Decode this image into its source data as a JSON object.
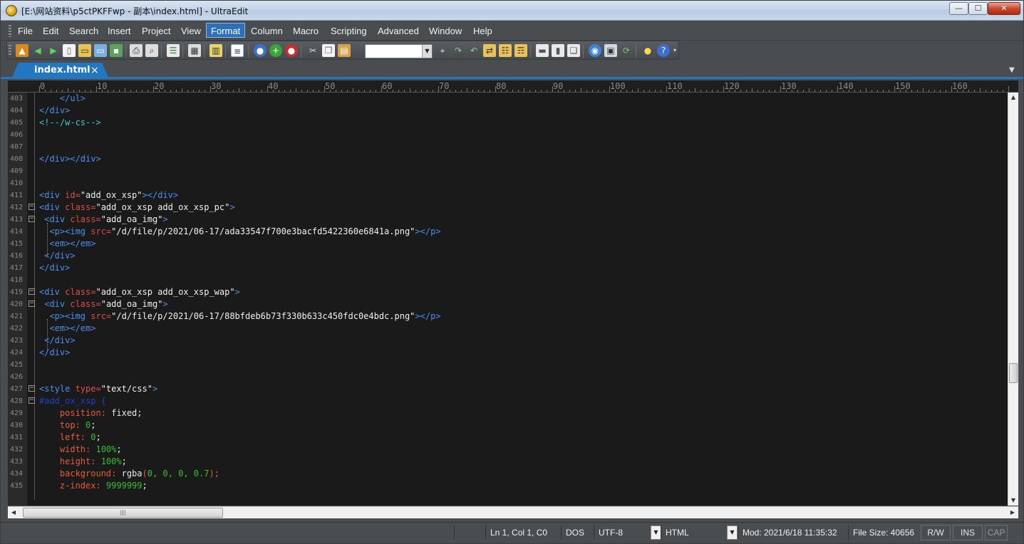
{
  "window": {
    "title": "[E:\\网站资料\\p5ctPKFFwp - 副本\\index.html] - UltraEdit"
  },
  "menu": [
    "File",
    "Edit",
    "Search",
    "Insert",
    "Project",
    "View",
    "Format",
    "Column",
    "Macro",
    "Scripting",
    "Advanced",
    "Window",
    "Help"
  ],
  "menu_active": "Format",
  "tab": {
    "label": "index.html",
    "close": "×"
  },
  "ruler": [
    "0",
    "10",
    "20",
    "30",
    "40",
    "50",
    "60",
    "70",
    "80",
    "90",
    "100",
    "110",
    "120",
    "130",
    "140",
    "150",
    "160"
  ],
  "lines": [
    {
      "n": "403",
      "tokens": [
        [
          "t",
          "    </ul>"
        ]
      ]
    },
    {
      "n": "404",
      "tokens": [
        [
          "t",
          "</div>"
        ]
      ]
    },
    {
      "n": "405",
      "tokens": [
        [
          "c",
          "<!--/w-cs-->"
        ]
      ]
    },
    {
      "n": "406",
      "tokens": []
    },
    {
      "n": "407",
      "tokens": []
    },
    {
      "n": "408",
      "tokens": [
        [
          "t",
          "</div></div>"
        ]
      ]
    },
    {
      "n": "409",
      "tokens": []
    },
    {
      "n": "410",
      "tokens": []
    },
    {
      "n": "411",
      "tokens": [
        [
          "t",
          "<div "
        ],
        [
          "a",
          "id="
        ],
        [
          "s",
          "\"add_ox_xsp\""
        ],
        [
          "t",
          "></div>"
        ]
      ]
    },
    {
      "n": "412",
      "fold": "−",
      "tokens": [
        [
          "t",
          "<div "
        ],
        [
          "a",
          "class="
        ],
        [
          "s",
          "\"add_ox_xsp add_ox_xsp_pc\""
        ],
        [
          "t",
          ">"
        ]
      ]
    },
    {
      "n": "413",
      "fold": "−",
      "tokens": [
        [
          "t",
          " <div "
        ],
        [
          "a",
          "class="
        ],
        [
          "s",
          "\"add_oa_img\""
        ],
        [
          "t",
          ">"
        ]
      ]
    },
    {
      "n": "414",
      "tokens": [
        [
          "t",
          "  <p><img "
        ],
        [
          "a",
          "src="
        ],
        [
          "s",
          "\"/d/file/p/2021/06-17/ada33547f700e3bacfd5422360e6841a.png\""
        ],
        [
          "t",
          "></p>"
        ]
      ]
    },
    {
      "n": "415",
      "tokens": [
        [
          "t",
          "  <em></em>"
        ]
      ]
    },
    {
      "n": "416",
      "tokens": [
        [
          "t",
          " </div>"
        ]
      ]
    },
    {
      "n": "417",
      "tokens": [
        [
          "t",
          "</div>"
        ]
      ]
    },
    {
      "n": "418",
      "tokens": []
    },
    {
      "n": "419",
      "fold": "−",
      "tokens": [
        [
          "t",
          "<div "
        ],
        [
          "a",
          "class="
        ],
        [
          "s",
          "\"add_ox_xsp add_ox_xsp_wap\""
        ],
        [
          "t",
          ">"
        ]
      ]
    },
    {
      "n": "420",
      "fold": "−",
      "tokens": [
        [
          "t",
          " <div "
        ],
        [
          "a",
          "class="
        ],
        [
          "s",
          "\"add_oa_img\""
        ],
        [
          "t",
          ">"
        ]
      ]
    },
    {
      "n": "421",
      "tokens": [
        [
          "t",
          "  <p><img "
        ],
        [
          "a",
          "src="
        ],
        [
          "s",
          "\"/d/file/p/2021/06-17/88bfdeb6b73f330b633c450fdc0e4bdc.png\""
        ],
        [
          "t",
          "></p>"
        ]
      ]
    },
    {
      "n": "422",
      "tokens": [
        [
          "t",
          "  <em></em>"
        ]
      ]
    },
    {
      "n": "423",
      "tokens": [
        [
          "t",
          " </div>"
        ]
      ]
    },
    {
      "n": "424",
      "tokens": [
        [
          "t",
          "</div>"
        ]
      ]
    },
    {
      "n": "425",
      "tokens": []
    },
    {
      "n": "426",
      "tokens": []
    },
    {
      "n": "427",
      "fold": "−",
      "tokens": [
        [
          "t",
          "<style "
        ],
        [
          "a",
          "type="
        ],
        [
          "s",
          "\"text/css\""
        ],
        [
          "t",
          ">"
        ]
      ]
    },
    {
      "n": "428",
      "fold": "−",
      "tokens": [
        [
          "sel",
          "#add_ox_xsp {"
        ]
      ]
    },
    {
      "n": "429",
      "tokens": [
        [
          "p",
          "    position: "
        ],
        [
          "v",
          "fixed;"
        ]
      ]
    },
    {
      "n": "430",
      "tokens": [
        [
          "p",
          "    top: "
        ],
        [
          "num",
          "0"
        ],
        [
          "v",
          ";"
        ]
      ]
    },
    {
      "n": "431",
      "tokens": [
        [
          "p",
          "    left: "
        ],
        [
          "num",
          "0"
        ],
        [
          "v",
          ";"
        ]
      ]
    },
    {
      "n": "432",
      "tokens": [
        [
          "p",
          "    width: "
        ],
        [
          "num",
          "100%"
        ],
        [
          "v",
          ";"
        ]
      ]
    },
    {
      "n": "433",
      "tokens": [
        [
          "p",
          "    height: "
        ],
        [
          "num",
          "100%"
        ],
        [
          "v",
          ";"
        ]
      ]
    },
    {
      "n": "434",
      "tokens": [
        [
          "p",
          "    background: "
        ],
        [
          "v",
          "rgba"
        ],
        [
          "p",
          "("
        ],
        [
          "num",
          "0, 0, 0, 0.7"
        ],
        [
          "p",
          ");"
        ]
      ]
    },
    {
      "n": "435",
      "tokens": [
        [
          "p",
          "    z-index: "
        ],
        [
          "num",
          "9999999"
        ],
        [
          "v",
          ";"
        ]
      ]
    }
  ],
  "status": {
    "position": "Ln 1, Col 1, C0",
    "line_ending": "DOS",
    "encoding": "UTF-8",
    "syntax": "HTML",
    "modified": "Mod: 2021/6/18 11:35:32",
    "file_size": "File Size: 40656",
    "rw": "R/W",
    "ins": "INS",
    "cap": "CAP"
  },
  "colors": {
    "tab_accent": "#2376c2",
    "editor_bg": "#1a1a1a",
    "tag": "#4b8ff0",
    "attr": "#e04a4a",
    "comment": "#3ec9c9",
    "number": "#33c033"
  }
}
